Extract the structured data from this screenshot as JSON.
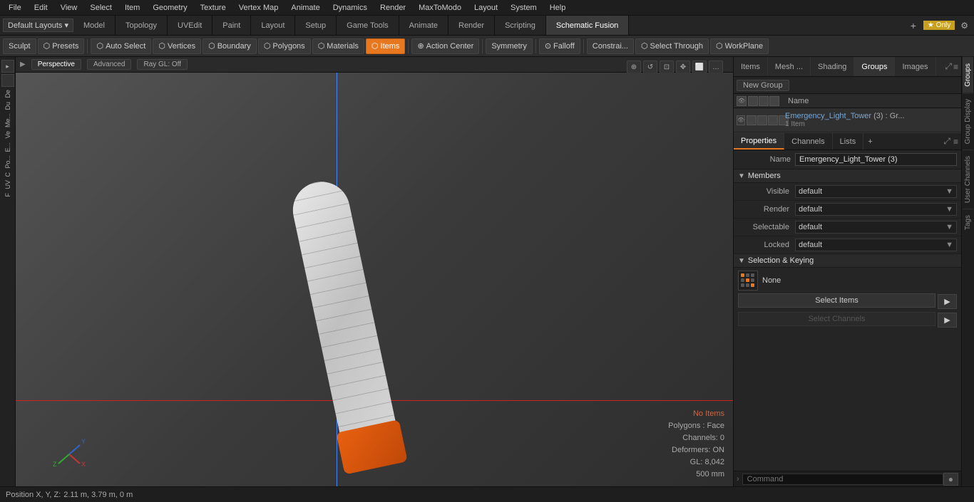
{
  "menuBar": {
    "items": [
      "File",
      "Edit",
      "View",
      "Select",
      "Item",
      "Geometry",
      "Texture",
      "Vertex Map",
      "Animate",
      "Dynamics",
      "Render",
      "MaxToModo",
      "Layout",
      "System",
      "Help"
    ]
  },
  "layoutBar": {
    "dropdown": "Default Layouts ▾",
    "tabs": [
      "Model",
      "Topology",
      "UVEdit",
      "Paint",
      "Layout",
      "Setup",
      "Game Tools",
      "Animate",
      "Render",
      "Scripting",
      "Schematic Fusion"
    ],
    "addBtn": "+",
    "starLabel": "★ Only",
    "optionsBtn": "⚙"
  },
  "toolbar": {
    "sculptLabel": "Sculpt",
    "presetsLabel": "Presets",
    "autoSelectLabel": "Auto Select",
    "verticesLabel": "Vertices",
    "boundaryLabel": "Boundary",
    "polygonsLabel": "Polygons",
    "materialsLabel": "Materials",
    "itemsLabel": "Items",
    "actionCenterLabel": "Action Center",
    "symmetryLabel": "Symmetry",
    "falloffLabel": "Falloff",
    "constraiLabel": "Constrai...",
    "selectThroughLabel": "Select Through",
    "workPlaneLabel": "WorkPlane"
  },
  "viewport": {
    "perspectiveLabel": "Perspective",
    "advancedLabel": "Advanced",
    "rayGLLabel": "Ray GL: Off",
    "noItems": "No Items",
    "polygonsFace": "Polygons : Face",
    "channels": "Channels: 0",
    "deformers": "Deformers: ON",
    "gl": "GL: 8,042",
    "size": "500 mm"
  },
  "statusBar": {
    "positionLabel": "Position X, Y, Z:",
    "positionValue": "2.11 m, 3.79 m, 0 m"
  },
  "rightPanel": {
    "tabs": [
      "Items",
      "Mesh ...",
      "Shading",
      "Groups",
      "Images"
    ],
    "activeTab": "Groups",
    "newGroupLabel": "New Group",
    "nameColumnLabel": "Name",
    "groupItem": {
      "name": "Emergency_Light_Tower",
      "suffix": " (3) : Gr...",
      "sub": "1 Item"
    }
  },
  "propsPanel": {
    "tabs": [
      "Properties",
      "Channels",
      "Lists"
    ],
    "activeTab": "Properties",
    "nameLabel": "Name",
    "nameValue": "Emergency_Light_Tower (3)",
    "membersLabel": "Members",
    "visibleLabel": "Visible",
    "visibleValue": "default",
    "renderLabel": "Render",
    "renderValue": "default",
    "selectableLabel": "Selectable",
    "selectableValue": "default",
    "lockedLabel": "Locked",
    "lockedValue": "default",
    "selKeyingLabel": "Selection & Keying",
    "noneLabel": "None",
    "selectItemsLabel": "Select Items",
    "selectChannelsLabel": "Select Channels"
  },
  "commandBar": {
    "placeholder": "Command",
    "btnLabel": "●"
  },
  "rightVTabs": {
    "tabs": [
      "Groups",
      "Group Display",
      "User Channels",
      "Tags"
    ]
  }
}
